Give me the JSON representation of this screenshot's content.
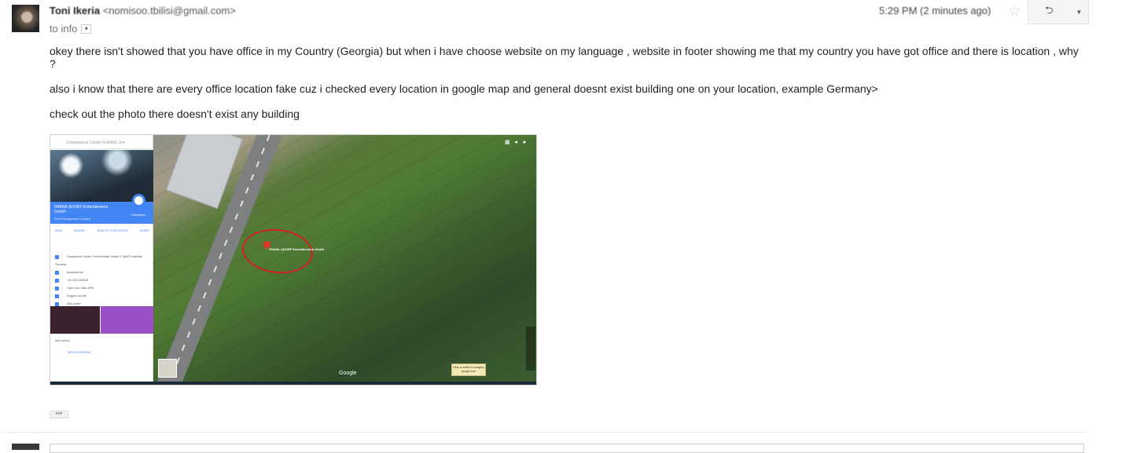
{
  "message": {
    "sender_name": "Toni Ikeria",
    "sender_email": "<nomisoo.tbilisi@gmail.com>",
    "to_label": "to info",
    "timestamp": "5:29 PM (2 minutes ago)",
    "paragraphs": [
      "okey there isn't showed that you have office in my Country (Georgia) but when i have choose website on my language , website in footer showing me that my country you have got office and there is location , why ?",
      "also  i know that there are every office location fake cuz i checked every location in google map and general doesnt exist building one on your location, example Germany>",
      "check out the photo there doesn't exist any building"
    ]
  },
  "toolbar": {
    "star_icon": "star-icon",
    "reply_icon": "reply-icon",
    "more_icon": "chevron-down-icon",
    "reply_glyph": "⮌",
    "more_glyph": "▼",
    "star_glyph": "☆"
  },
  "attachment": {
    "search_placeholder": "Competence Center Rothfeld, Em",
    "business_name": "FRANK ADORF Entertainment GmbH",
    "business_category": "Event Management Company",
    "directions_label": "Directions",
    "actions": [
      "SAVE",
      "NEARBY",
      "SEND TO YOUR PHONE",
      "SHARE"
    ],
    "details": [
      "Competence Center, Frechenthaler Straße 2, 86875 Kaltental, Germany",
      "frankadorf.de",
      "+49 241 1335192",
      "Open now: 9AM–6PM",
      "Suggest an edit",
      "Add a label"
    ],
    "add_photo_label": "Add a photo",
    "website_label": "WRITE A REVIEW",
    "pin_label": "FRANK ADORF Entertainment GmbH",
    "google_label": "Google",
    "tooltip_label": "Click to switch to Imagery google.com"
  },
  "footer": {
    "ellipsis_label": "•••"
  }
}
